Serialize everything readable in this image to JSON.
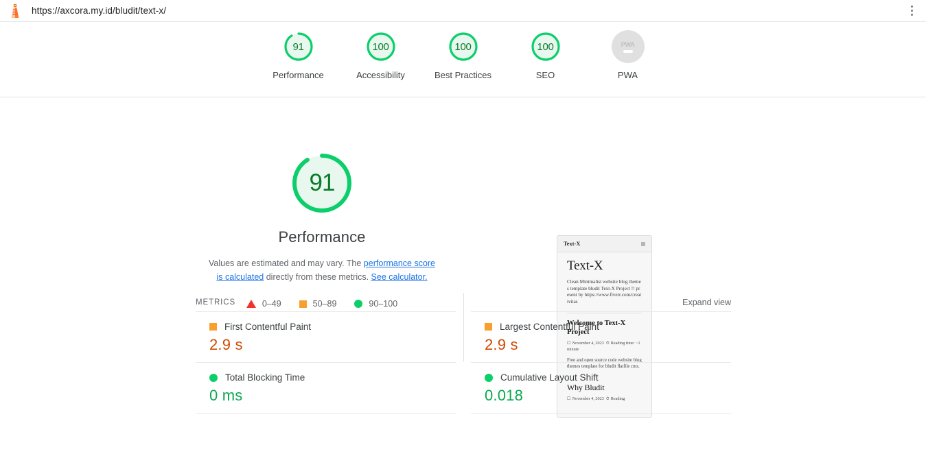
{
  "browser": {
    "url": "https://axcora.my.id/bludit/text-x/",
    "menu_icon": "kebab-menu-icon",
    "logo_icon": "lighthouse-logo-icon"
  },
  "colors": {
    "pass": "#0cce6b",
    "pass_text": "#0b7a29",
    "average": "#fa9f2e",
    "average_text": "#d04a02",
    "fail": "#f4322c",
    "link": "#1a73e8",
    "null_gray": "#e0e0e0"
  },
  "scores": [
    {
      "value": "91",
      "label": "Performance",
      "percent": 91,
      "state": "pass"
    },
    {
      "value": "100",
      "label": "Accessibility",
      "percent": 100,
      "state": "pass"
    },
    {
      "value": "100",
      "label": "Best Practices",
      "percent": 100,
      "state": "pass"
    },
    {
      "value": "100",
      "label": "SEO",
      "percent": 100,
      "state": "pass"
    },
    {
      "value": "PWA",
      "label": "PWA",
      "percent": 0,
      "state": "null"
    }
  ],
  "performance": {
    "score": "91",
    "title": "Performance",
    "description_part1": "Values are estimated and may vary. The ",
    "link1": "performance score is calculated",
    "description_part2": " directly from these metrics. ",
    "link2": "See calculator.",
    "legend": [
      {
        "marker": "triangle-icon",
        "range": "0–49"
      },
      {
        "marker": "square-icon",
        "range": "50–89"
      },
      {
        "marker": "circle-icon",
        "range": "90–100"
      }
    ]
  },
  "thumbnail": {
    "header_title": "Text-X",
    "menu_icon": "hamburger-icon",
    "site_title": "Text-X",
    "site_tagline": "Clean Minimalist website blog themes template bludit Text-X Project !! present by https://www.fiverr.com/creativitas",
    "post1_title": "Welcome to Text-X Project",
    "post1_date": "November 4, 2023",
    "post1_reading": "Reading time: ~1 minute",
    "post1_excerpt": "Free and open source code website blog themes template for bludit flatfile cms.",
    "post2_title": "Why Bludit",
    "post2_date": "November 4, 2023",
    "post2_reading": "Reading",
    "calendar_icon": "calendar-icon",
    "clock_icon": "clock-icon"
  },
  "metrics": {
    "section_title": "METRICS",
    "expand_label": "Expand view",
    "left": [
      {
        "marker": "square-icon",
        "state": "average",
        "name": "First Contentful Paint",
        "value": "2.9 s"
      },
      {
        "marker": "circle-icon",
        "state": "pass",
        "name": "Total Blocking Time",
        "value": "0 ms"
      }
    ],
    "right": [
      {
        "marker": "square-icon",
        "state": "average",
        "name": "Largest Contentful Paint",
        "value": "2.9 s"
      },
      {
        "marker": "circle-icon",
        "state": "pass",
        "name": "Cumulative Layout Shift",
        "value": "0.018"
      }
    ]
  }
}
